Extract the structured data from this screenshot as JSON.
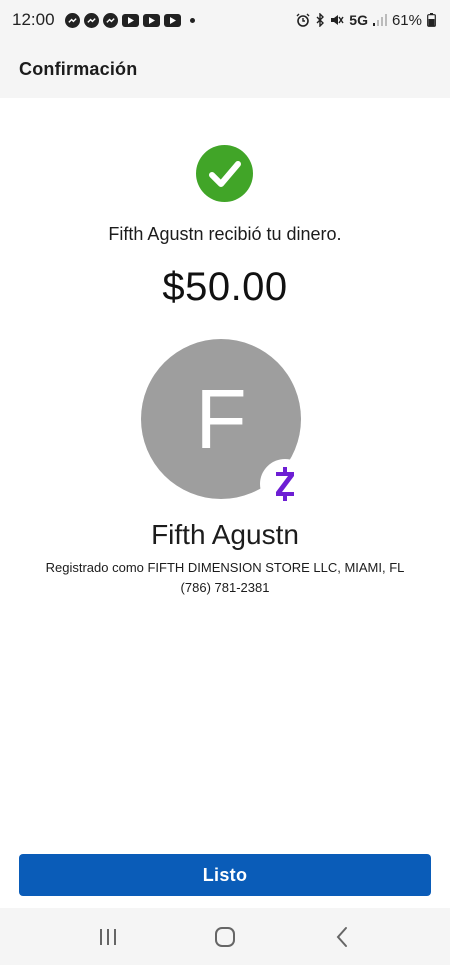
{
  "status_bar": {
    "time": "12:00",
    "network": "5G",
    "battery": "61%",
    "notification_icons": [
      "messenger-icon",
      "messenger-icon",
      "messenger-icon",
      "youtube-icon",
      "youtube-icon",
      "youtube-icon"
    ],
    "system_icons": [
      "alarm-icon",
      "bluetooth-icon",
      "mute-icon",
      "signal-icon",
      "battery-icon"
    ]
  },
  "header": {
    "title": "Confirmación"
  },
  "confirmation": {
    "message": "Fifth Agustn recibió tu dinero.",
    "amount": "$50.00",
    "success_color": "#41a528"
  },
  "recipient": {
    "initial": "F",
    "name": "Fifth Agustn",
    "registered_as": "Registrado como FIFTH DIMENSION STORE LLC, MIAMI, FL",
    "phone": "(786) 781-2381",
    "avatar_color": "#9e9e9e",
    "badge": "zelle-icon",
    "badge_color": "#6d1ed4"
  },
  "actions": {
    "done_label": "Listo",
    "done_color": "#0a5cb8"
  },
  "nav_bar": {
    "buttons": [
      "recent-apps-icon",
      "home-icon",
      "back-icon"
    ]
  }
}
